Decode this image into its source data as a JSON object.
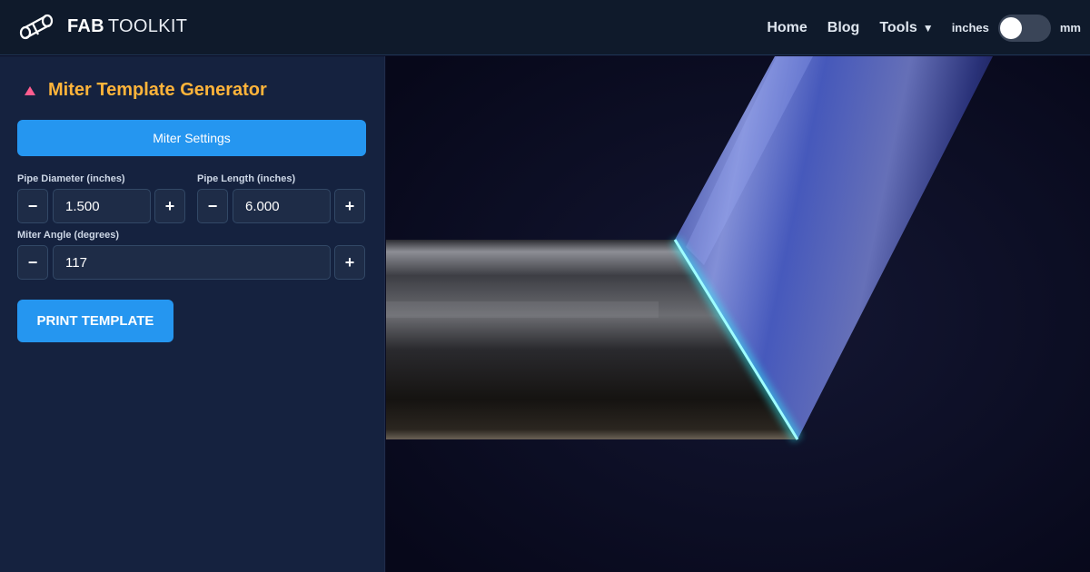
{
  "header": {
    "brand_bold": "FAB",
    "brand_light": "TOOLKIT",
    "nav": [
      "Home",
      "Blog"
    ],
    "tools_label": "Tools",
    "units_left": "inches",
    "units_right": "mm"
  },
  "panel": {
    "title": "Miter Template Generator",
    "settings_button": "Miter Settings",
    "pipe_diameter": {
      "label": "Pipe Diameter (inches)",
      "value": "1.500"
    },
    "pipe_length": {
      "label": "Pipe Length (inches)",
      "value": "6.000"
    },
    "miter_angle": {
      "label": "Miter Angle (degrees)",
      "value": "117"
    },
    "minus": "−",
    "plus": "+",
    "print_button": "PRINT TEMPLATE"
  },
  "colors": {
    "accent": "#2596f0",
    "title": "#ffb43a",
    "triangle": "#ff5d8f",
    "weld_glow": "#2ff5ff"
  },
  "icons": {
    "logo": "pipe-tool-icon",
    "tools_caret": "caret-down-icon",
    "section": "triangle-up-icon"
  }
}
